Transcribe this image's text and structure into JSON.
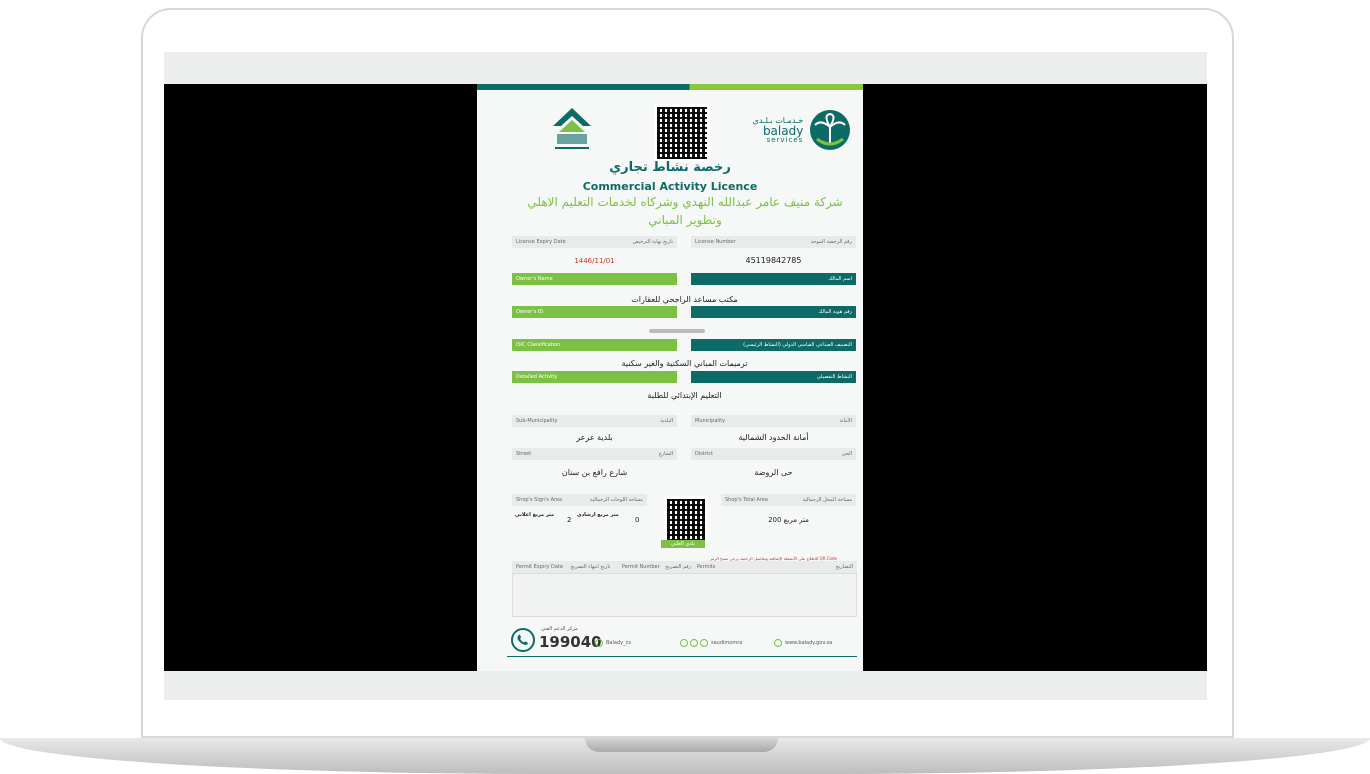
{
  "colors": {
    "teal": "#0e6a66",
    "green": "#7cc143",
    "red": "#c0392b"
  },
  "header": {
    "brand_ar": "خـدمـات بـلـدي",
    "brand_en": "balady",
    "brand_sub": "services"
  },
  "title_ar": "رخصة نشاط تجاري",
  "title_en": "Commercial Activity Licence",
  "company_name": "شركة منيف عامر عبدالله النهدي وشركاه لخدمات التعليم الاهلي وتطوير المباني",
  "fields": {
    "expiry_label_en": "License Expiry Date",
    "expiry_label_ar": "تاريخ نهاية الترخيص",
    "expiry_value": "1446/11/01",
    "number_label_en": "License Number",
    "number_label_ar": "رقم الرخصة الموحد",
    "number_value": "45119842785",
    "owner_label_en": "Owner's Name",
    "owner_label_ar": "اسم المالك",
    "owner_value": "مكتب مساعد الراجحي للعقارات",
    "owner_id_label_en": "Owner's ID",
    "owner_id_label_ar": "رقم هوية المالك",
    "isic_label_en": "ISIC Classification",
    "isic_label_ar": "التصنيف الصناعي القياسي الدولي (النشاط الرئيسي)",
    "isic_value": "ترميمات المباني السكنية والغير سكنية",
    "detail_label_en": "Detailed Activity",
    "detail_label_ar": "النشاط التفصيلي",
    "detail_value": "التعليم الإبتدائي للطلبة",
    "submun_label_en": "Sub-Municipality",
    "submun_label_ar": "البلدية",
    "submun_value": "بلدية عرعر",
    "mun_label_en": "Municipality",
    "mun_label_ar": "الأمانة",
    "mun_value": "أمانة الحدود الشمالية",
    "street_label_en": "Street",
    "street_label_ar": "الشارع",
    "street_value": "شارع رافع بن سنان",
    "district_label_en": "District",
    "district_label_ar": "الحي",
    "district_value": "حى الروضة",
    "sign_label_en": "Shop's Sign's Area",
    "sign_label_ar": "مساحة اللوحات الرجمالية",
    "sign_value_a": "0",
    "sign_value_b": "2",
    "sign_unit_a": "متر مربع ارشادي",
    "sign_unit_b": "متر مربع اعلاني",
    "total_label_en": "Shop's Total Area",
    "total_label_ar": "مساحة المحل الرجمالية",
    "total_value": "200 متر مربع",
    "qr_caption": "بلدي العلني"
  },
  "permits": {
    "note": "للاطلاع على الأنشطة الإضافية وتفاصيل الرخصة يرجى مسح الرمز QR Code",
    "expiry_en": "Permit Expiry Date",
    "expiry_ar": "تاريخ انتهاء التصريح",
    "number_en": "Permit Number",
    "number_ar": "رقم التصريح",
    "permits_en": "Permits",
    "permits_ar": "التصاريح"
  },
  "footer": {
    "support_label": "مركز الدعم الفني",
    "phone": "199040",
    "twitter_cs": "Balady_cs",
    "social": "saudimomra",
    "website": "www.balady.gov.sa"
  }
}
